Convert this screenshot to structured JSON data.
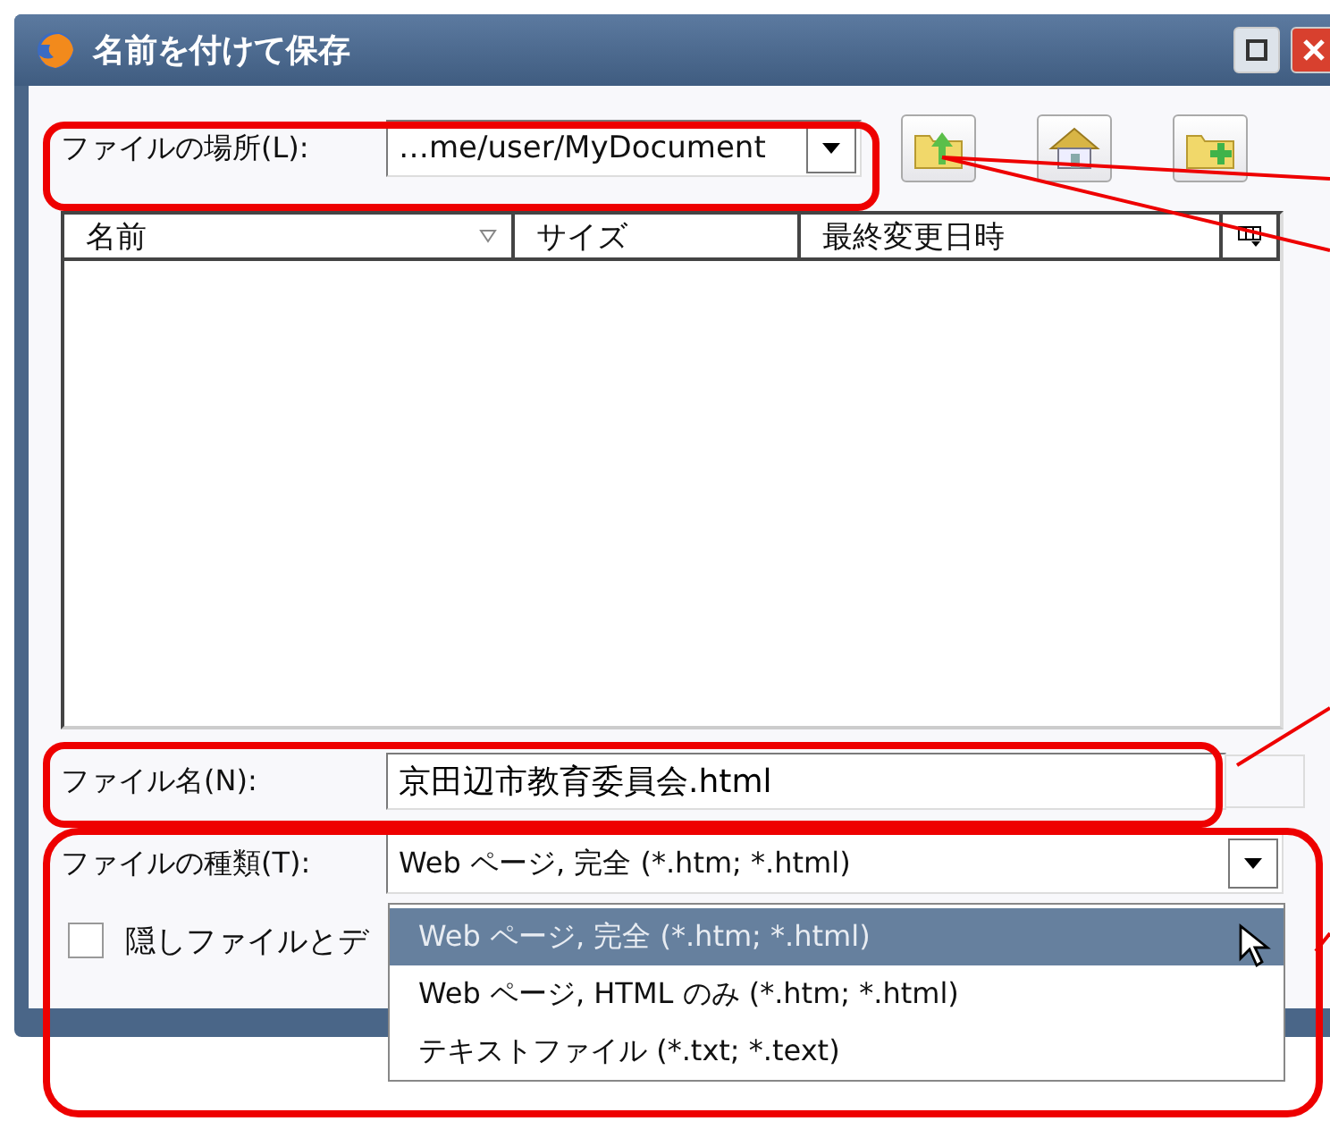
{
  "window": {
    "title": "名前を付けて保存"
  },
  "location": {
    "label": "ファイルの場所(L):",
    "value": "…me/user/MyDocument"
  },
  "columns": [
    "名前",
    "サイズ",
    "最終変更日時"
  ],
  "filename": {
    "label": "ファイル名(N):",
    "value": "京田辺市教育委員会.html"
  },
  "filetype": {
    "label": "ファイルの種類(T):",
    "value": "Web ページ, 完全 (*.htm; *.html)",
    "expanded": true,
    "options": [
      {
        "label": "Web ページ, 完全 (*.htm; *.html)",
        "selected": true
      },
      {
        "label": "Web ページ, HTML のみ (*.htm; *.html)",
        "selected": false
      },
      {
        "label": "テキストファイル (*.txt; *.text)",
        "selected": false
      }
    ]
  },
  "hidden_files": {
    "label": "隠しファイルとデ",
    "checked": false
  }
}
